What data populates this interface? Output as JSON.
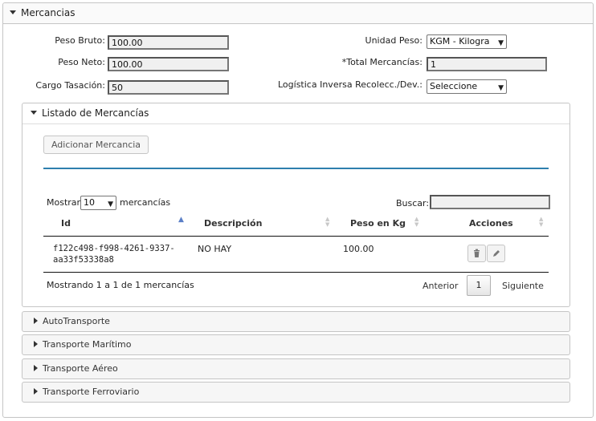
{
  "panel": {
    "title": "Mercancias"
  },
  "form": {
    "peso_bruto": {
      "label": "Peso Bruto:",
      "value": "100.00"
    },
    "peso_neto": {
      "label": "Peso Neto:",
      "value": "100.00"
    },
    "cargo_tasacion": {
      "label": "Cargo Tasación:",
      "value": "50"
    },
    "unidad_peso": {
      "label": "Unidad Peso:",
      "value": "KGM - Kilogra"
    },
    "total_mercancias": {
      "label": "*Total Mercancías:",
      "value": "1"
    },
    "logistica": {
      "label": "Logística Inversa Recolecc./Dev.:",
      "value": "Seleccione"
    }
  },
  "listado": {
    "title": "Listado de Mercancías",
    "add_button": "Adicionar Mercancia",
    "show_prefix": "Mostrar",
    "show_value": "10",
    "show_suffix": "mercancías",
    "search_label": "Buscar:",
    "search_value": "",
    "columns": [
      "Id",
      "Descripción",
      "Peso en Kg",
      "Acciones"
    ],
    "rows": [
      {
        "id_line1": "f122c498-f998-4261-9337-",
        "id_line2": "aa33f53338a8",
        "descripcion": "NO HAY",
        "peso": "100.00"
      }
    ],
    "info": "Mostrando 1 a 1 de 1 mercancías",
    "prev": "Anterior",
    "page": "1",
    "next": "Siguiente"
  },
  "sections": [
    "AutoTransporte",
    "Transporte Marítimo",
    "Transporte Aéreo",
    "Transporte Ferroviario"
  ],
  "colors": {
    "accent": "#2e7fae",
    "sort_active": "#5b7fc7"
  }
}
